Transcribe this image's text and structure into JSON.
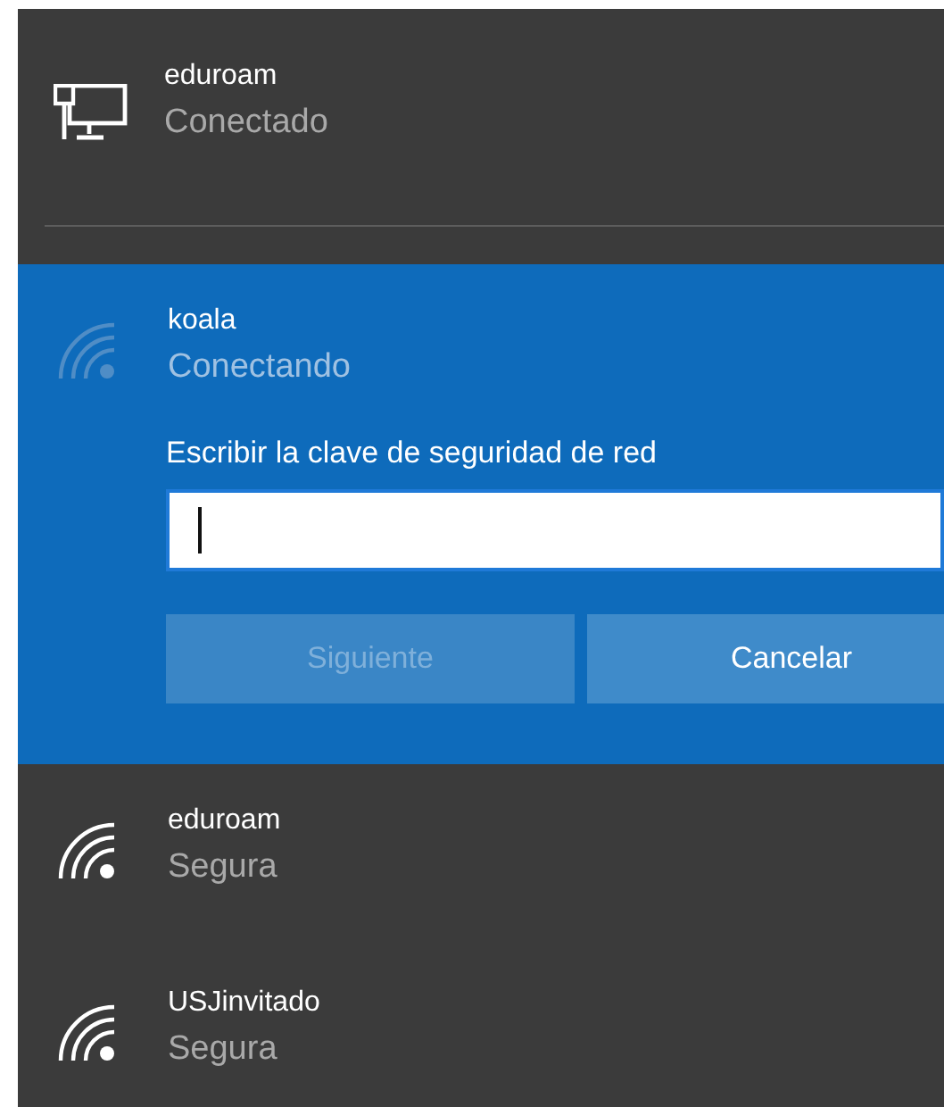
{
  "networks": [
    {
      "kind": "wired",
      "name": "eduroam",
      "status": "Conectado",
      "selected": false
    },
    {
      "kind": "wifi",
      "name": "koala",
      "status": "Conectando",
      "selected": true,
      "prompt": "Escribir la clave de seguridad de red",
      "password_field": {
        "focused": true
      },
      "buttons": [
        {
          "label": "Siguiente",
          "disabled": true
        },
        {
          "label": "Cancelar",
          "disabled": false
        }
      ]
    },
    {
      "kind": "wifi",
      "name": "eduroam",
      "status": "Segura",
      "selected": false
    },
    {
      "kind": "wifi",
      "name": "USJinvitado",
      "status": "Segura",
      "selected": false
    }
  ]
}
